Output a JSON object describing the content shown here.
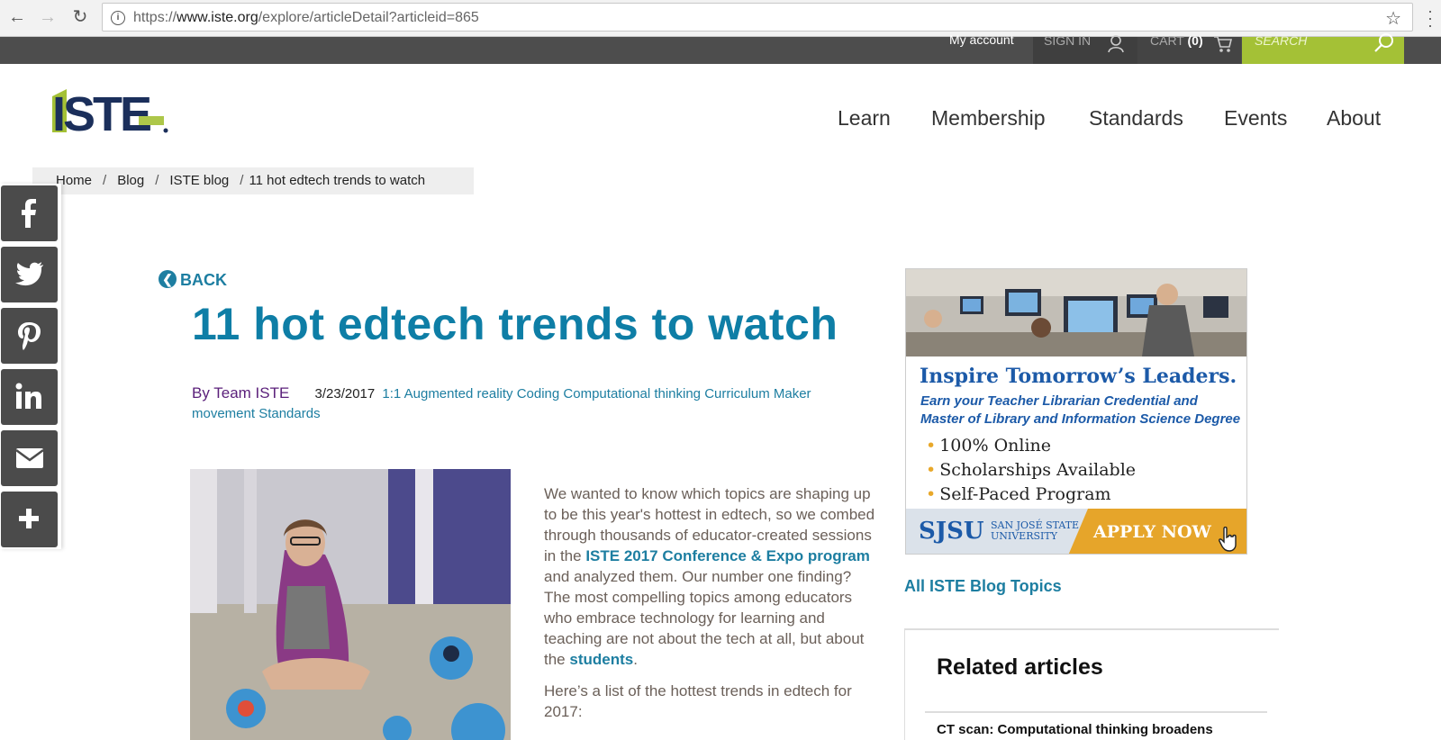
{
  "browser": {
    "url_prefix": "https://",
    "url_host": "www.iste.org",
    "url_path": "/explore/articleDetail?articleid=865"
  },
  "utilbar": {
    "account": "My account",
    "signin": "SIGN IN",
    "cart": "CART",
    "cart_count": "(0)",
    "search_placeholder": "SEARCH"
  },
  "logo": {
    "text": "ISTE"
  },
  "nav": [
    "Learn",
    "Membership",
    "Standards",
    "Events",
    "About"
  ],
  "breadcrumb": [
    "Home",
    "Blog",
    "ISTE blog",
    "11 hot edtech trends to watch"
  ],
  "social": [
    "facebook",
    "twitter",
    "pinterest",
    "linkedin",
    "email",
    "more"
  ],
  "article": {
    "back": "BACK",
    "title": "11 hot edtech trends to watch",
    "author": "By Team ISTE",
    "date": "3/23/2017",
    "tags": [
      "1:1",
      "Augmented reality",
      "Coding",
      "Computational thinking",
      "Curriculum",
      "Maker movement",
      "Standards"
    ],
    "para1_a": "We wanted to know which topics are shaping up to be this year's hottest in edtech, so we combed through thousands of educator-created sessions in the ",
    "para1_link": "ISTE 2017 Conference & Expo program",
    "para1_b": " and analyzed them. Our number one finding? The most compelling topics among educators who embrace technology for learning and teaching are not about the tech at all, but about the ",
    "para1_link2": "students",
    "para1_c": ".",
    "para2": "Here’s a list of the hottest trends in edtech for 2017:"
  },
  "ad": {
    "headline": "Inspire Tomorrow’s Leaders.",
    "sub": "Earn your Teacher Librarian Credential and Master of Library and Information Science Degree",
    "bullets": [
      "100% Online",
      "Scholarships Available",
      "Self-Paced Program"
    ],
    "school": "SJSU",
    "school_sub1": "SAN JOSÉ STATE",
    "school_sub2": "UNIVERSITY",
    "cta": "APPLY NOW"
  },
  "sidebar": {
    "topics_link": "All ISTE Blog Topics",
    "related_heading": "Related articles",
    "related_item": "CT scan: Computational thinking broadens"
  }
}
